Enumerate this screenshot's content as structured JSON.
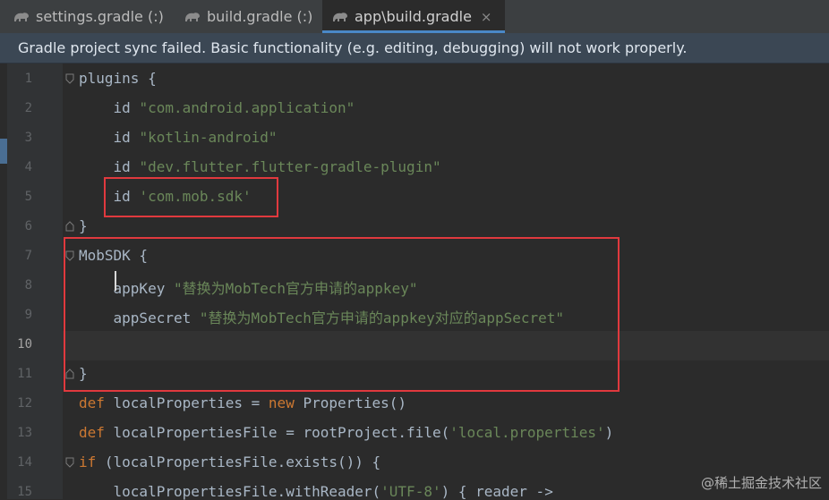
{
  "tabs": [
    {
      "label": "settings.gradle (:)",
      "active": false,
      "icon": "gradle-elephant-icon"
    },
    {
      "label": "build.gradle (:)",
      "active": false,
      "icon": "gradle-elephant-icon"
    },
    {
      "label": "app\\build.gradle",
      "active": true,
      "icon": "gradle-elephant-icon",
      "close": "×"
    }
  ],
  "banner": {
    "text": "Gradle project sync failed. Basic functionality (e.g. editing, debugging) will not work properly."
  },
  "editor": {
    "current_line": 10,
    "lines": [
      {
        "n": "1",
        "tokens": [
          {
            "t": "plugins {",
            "c": "plain"
          }
        ]
      },
      {
        "n": "2",
        "tokens": [
          {
            "t": "    id ",
            "c": "plain"
          },
          {
            "t": "\"com.android.application\"",
            "c": "str"
          }
        ]
      },
      {
        "n": "3",
        "tokens": [
          {
            "t": "    id ",
            "c": "plain"
          },
          {
            "t": "\"kotlin-android\"",
            "c": "str"
          }
        ]
      },
      {
        "n": "4",
        "tokens": [
          {
            "t": "    id ",
            "c": "plain"
          },
          {
            "t": "\"dev.flutter.flutter-gradle-plugin\"",
            "c": "str"
          }
        ]
      },
      {
        "n": "5",
        "tokens": [
          {
            "t": "    id ",
            "c": "plain"
          },
          {
            "t": "'com.mob.sdk'",
            "c": "str"
          }
        ]
      },
      {
        "n": "6",
        "tokens": [
          {
            "t": "}",
            "c": "plain"
          }
        ]
      },
      {
        "n": "7",
        "tokens": [
          {
            "t": "MobSDK {",
            "c": "plain"
          }
        ]
      },
      {
        "n": "8",
        "tokens": [
          {
            "t": "    appKey ",
            "c": "plain"
          },
          {
            "t": "\"替换为MobTech官方申请的appkey\"",
            "c": "str"
          }
        ]
      },
      {
        "n": "9",
        "tokens": [
          {
            "t": "    appSecret ",
            "c": "plain"
          },
          {
            "t": "\"替换为MobTech官方申请的appkey对应的appSecret\"",
            "c": "str"
          }
        ]
      },
      {
        "n": "10",
        "tokens": []
      },
      {
        "n": "11",
        "tokens": [
          {
            "t": "}",
            "c": "plain"
          }
        ]
      },
      {
        "n": "12",
        "tokens": [
          {
            "t": "def ",
            "c": "kw"
          },
          {
            "t": "localProperties = ",
            "c": "plain"
          },
          {
            "t": "new ",
            "c": "kw"
          },
          {
            "t": "Properties()",
            "c": "plain"
          }
        ]
      },
      {
        "n": "13",
        "tokens": [
          {
            "t": "def ",
            "c": "kw"
          },
          {
            "t": "localPropertiesFile = rootProject.file(",
            "c": "plain"
          },
          {
            "t": "'local.properties'",
            "c": "str"
          },
          {
            "t": ")",
            "c": "plain"
          }
        ]
      },
      {
        "n": "14",
        "tokens": [
          {
            "t": "if ",
            "c": "kw"
          },
          {
            "t": "(localPropertiesFile.exists()) {",
            "c": "plain"
          }
        ]
      },
      {
        "n": "15",
        "tokens": [
          {
            "t": "    localPropertiesFile.withReader(",
            "c": "plain"
          },
          {
            "t": "'UTF-8'",
            "c": "str"
          },
          {
            "t": ") { reader ->",
            "c": "plain"
          }
        ]
      }
    ]
  },
  "watermark": "@稀土掘金技术社区",
  "colors": {
    "highlight_box": "#e0393e",
    "keyword": "#cc7832",
    "string": "#6a8759",
    "text": "#a9b7c6",
    "banner_bg": "#3b4754"
  }
}
